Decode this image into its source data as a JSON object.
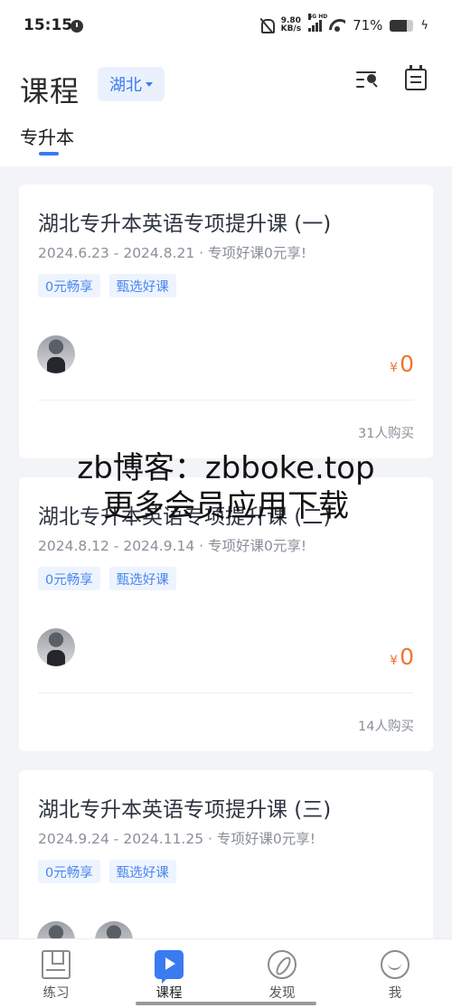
{
  "status_bar": {
    "time": "15:15",
    "net_speed_value": "9.80",
    "net_speed_unit": "KB/s",
    "signal_label": "5G HD",
    "battery_percent": "71%",
    "battery_level": 0.71
  },
  "header": {
    "title": "课程",
    "region": "湖北",
    "tab": "专升本"
  },
  "courses": [
    {
      "title": "湖北专升本英语专项提升课 (一)",
      "meta": "2024.6.23 - 2024.8.21 · 专项好课0元享!",
      "tags": [
        "0元畅享",
        "甄选好课"
      ],
      "price_currency": "¥",
      "price": "0",
      "purchase_count": "31人购买"
    },
    {
      "title": "湖北专升本英语专项提升课 (二)",
      "meta": "2024.8.12 - 2024.9.14 · 专项好课0元享!",
      "tags": [
        "0元畅享",
        "甄选好课"
      ],
      "price_currency": "¥",
      "price": "0",
      "purchase_count": "14人购买"
    },
    {
      "title": "湖北专升本英语专项提升课 (三)",
      "meta": "2024.9.24 - 2024.11.25 · 专项好课0元享!",
      "tags": [
        "0元畅享",
        "甄选好课"
      ]
    }
  ],
  "watermark": {
    "line1": "zb博客：zbboke.top",
    "line2": "更多会员应用下载"
  },
  "bottom_nav": [
    {
      "label": "练习",
      "icon": "book-icon"
    },
    {
      "label": "课程",
      "icon": "play-icon"
    },
    {
      "label": "发现",
      "icon": "compass-icon"
    },
    {
      "label": "我",
      "icon": "smile-icon"
    }
  ],
  "colors": {
    "accent": "#3b7bf0",
    "price": "#f0742f",
    "background": "#f3f4f8"
  }
}
